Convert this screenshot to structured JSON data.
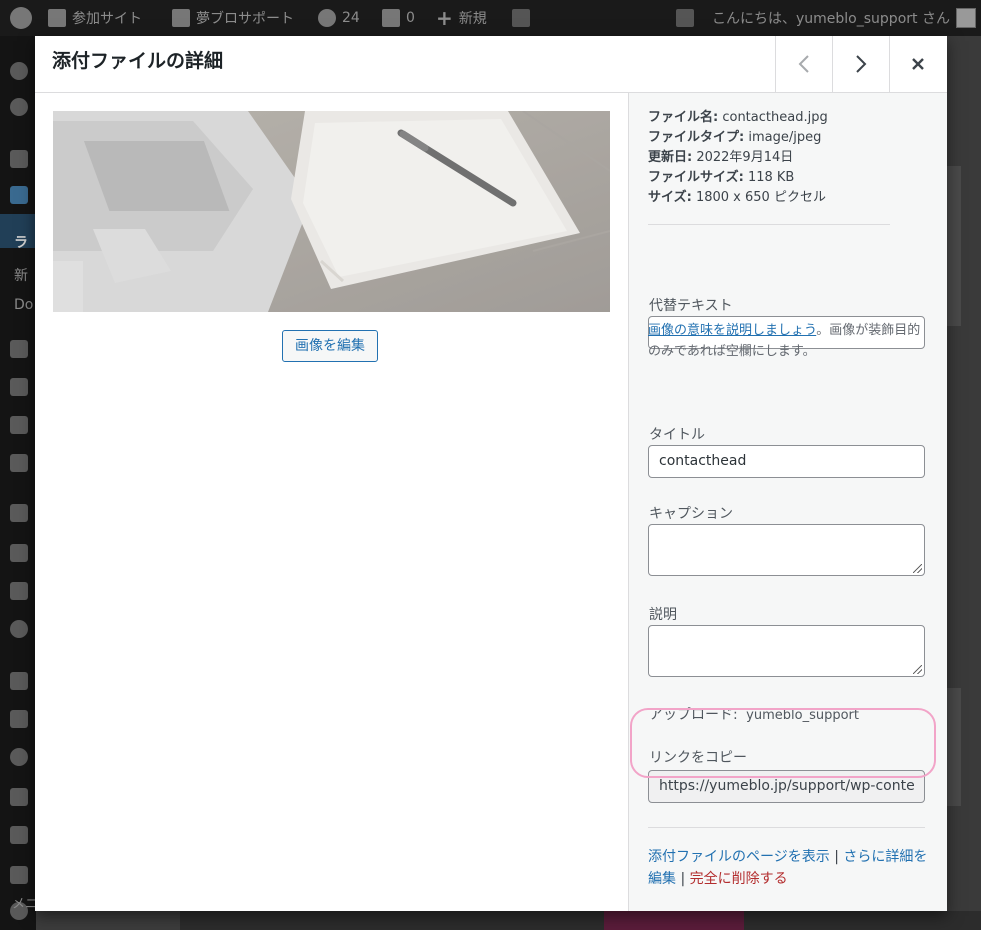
{
  "adminbar": {
    "site_name": "参加サイト",
    "my_site": "夢ブロサポート",
    "updates_count": "24",
    "comments_count": "0",
    "new_label": "新規",
    "greeting": "こんにちは、yumeblo_support さん"
  },
  "sidemenu": {
    "item_partial_1": "ラ",
    "item_partial_2": "新",
    "item_partial_3": "Do",
    "collapse_label": "メニューを閉じる"
  },
  "modal": {
    "title": "添付ファイルの詳細",
    "prev_icon": "chevron-left-icon",
    "next_icon": "chevron-right-icon",
    "close_icon": "close-icon"
  },
  "media": {
    "edit_button": "画像を編集"
  },
  "details": {
    "filename_label": "ファイル名:",
    "filename_value": "contacthead.jpg",
    "filetype_label": "ファイルタイプ:",
    "filetype_value": "image/jpeg",
    "updated_label": "更新日:",
    "updated_value": "2022年9月14日",
    "filesize_label": "ファイルサイズ:",
    "filesize_value": "118 KB",
    "size_label": "サイズ:",
    "size_value": "1800 x 650 ピクセル"
  },
  "fields": {
    "alt_label": "代替テキスト",
    "alt_value": "",
    "alt_help_link": "画像の意味を説明しましょう",
    "alt_help_text": "。画像が装飾目的のみであれば空欄にします。",
    "title_label": "タイトル",
    "title_value": "contacthead",
    "caption_label": "キャプション",
    "caption_value": "",
    "description_label": "説明",
    "description_value": "",
    "uploaded_by_label": "アップロード:",
    "uploaded_by_value": "yumeblo_support",
    "copy_link_label": "リンクをコピー",
    "copy_link_value": "https://yumeblo.jp/support/wp-conte"
  },
  "actions": {
    "view_page": "添付ファイルのページを表示",
    "separator": "|",
    "edit_more": "さらに詳細を編集",
    "delete": "完全に削除する"
  },
  "colors": {
    "accent": "#2271b1",
    "danger": "#b32d2e",
    "highlight": "#f2a4c8"
  }
}
